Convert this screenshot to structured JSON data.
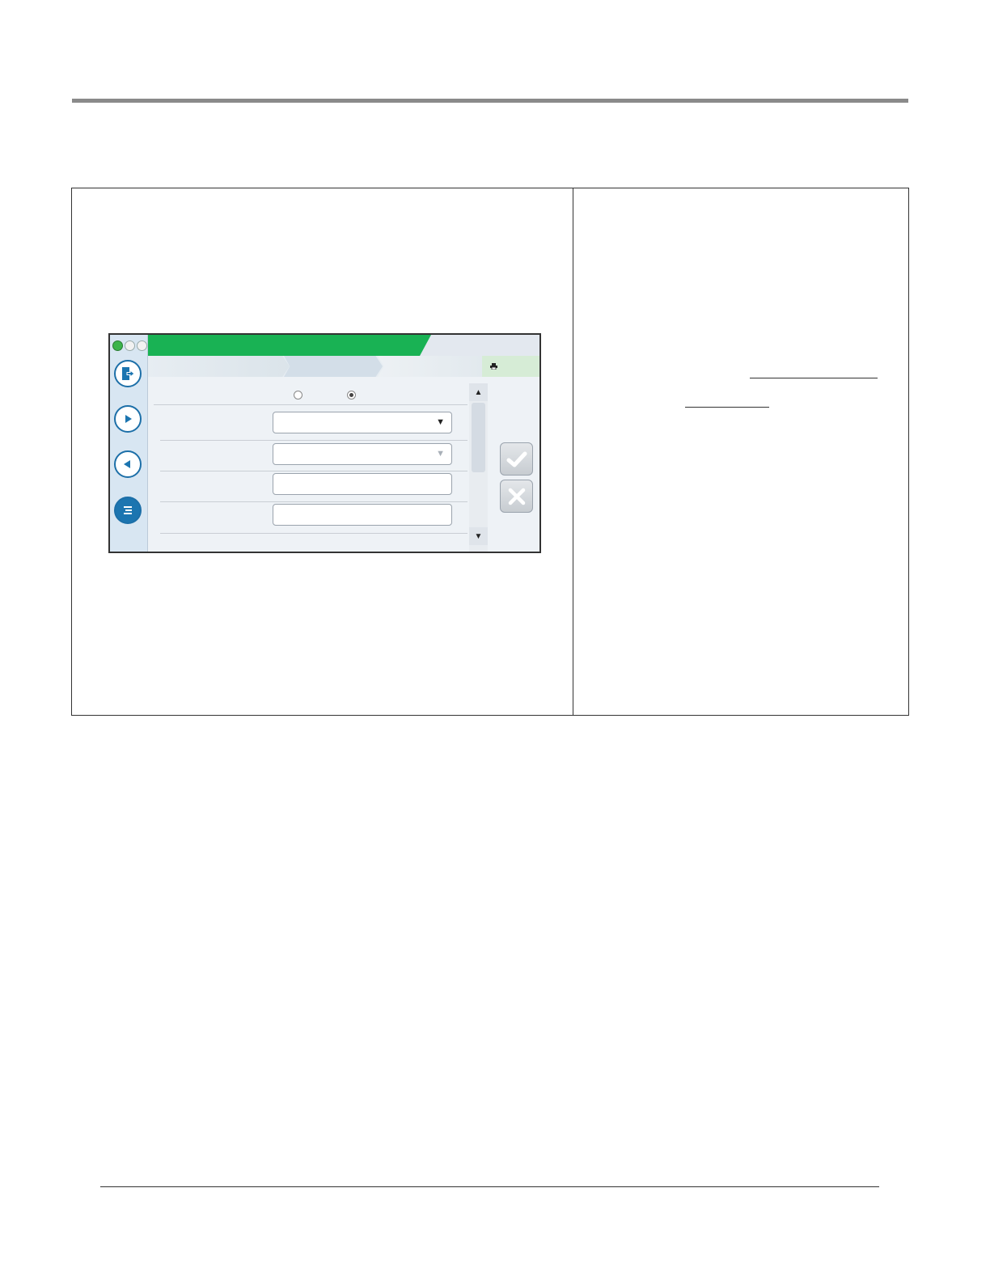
{
  "page": {
    "colors": {
      "rule": "#8a8a8a",
      "border": "#333333"
    }
  },
  "device_screen": {
    "status_lights": [
      "green-light",
      "off-light",
      "off-light"
    ],
    "sidebar_icons": [
      "exit-icon",
      "play-forward-icon",
      "play-back-icon",
      "menu-icon"
    ],
    "title_bar_color": "#19b254",
    "print_icon": "printer-icon",
    "radio_options": [
      {
        "selected": false
      },
      {
        "selected": true
      }
    ],
    "fields": [
      {
        "type": "dropdown",
        "enabled": true
      },
      {
        "type": "dropdown",
        "enabled": false
      },
      {
        "type": "text"
      },
      {
        "type": "text"
      }
    ],
    "scroll_icons": [
      "arrow-up-icon",
      "arrow-down-icon"
    ],
    "action_icons": [
      "checkmark-icon",
      "close-icon"
    ]
  }
}
